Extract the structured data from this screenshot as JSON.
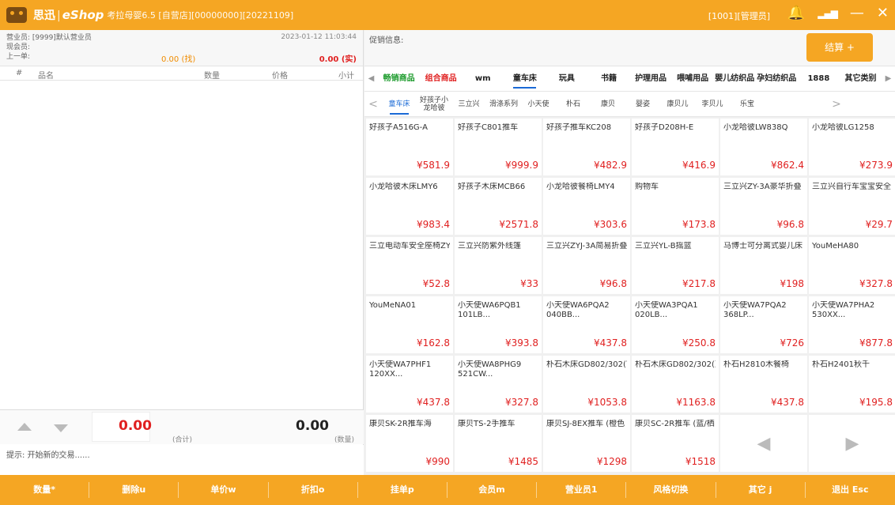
{
  "titlebar": {
    "brand": "思迅",
    "sep": "|",
    "product": "eShop",
    "subtitle": "考拉母婴6.5 [自营店][00000000][20221109]",
    "user": "[1001][管理员]"
  },
  "order": {
    "clerk": "营业员: [9999]默认营业员",
    "member": "现会员:",
    "last": "上一单:",
    "datetime": "2023-01-12 11:03:44",
    "change": "0.00 (找)",
    "paid": "0.00 (实)",
    "columns": [
      "#",
      "品名",
      "数量",
      "价格",
      "小计"
    ],
    "total_amount": "0.00",
    "total_label": "(合计)",
    "qty_amount": "0.00",
    "qty_label": "(数量)",
    "hint": "提示: 开始新的交易......"
  },
  "promo": {
    "label": "促销信息:",
    "checkout": "结算 +"
  },
  "categories": [
    "畅销商品",
    "组合商品",
    "wm",
    "童车床",
    "玩具",
    "书籍",
    "护理用品",
    "喂哺用品",
    "婴儿纺织品",
    "孕妇纺织品",
    "1888",
    "其它类别"
  ],
  "subcategories": [
    "童车床",
    "好孩子小龙哈彼",
    "三立兴",
    "滑涤系列",
    "小天使",
    "朴石",
    "康贝",
    "婴姿",
    "康贝儿",
    "李贝儿",
    "乐宝"
  ],
  "products": [
    {
      "name": "好孩子A516G-A",
      "price": "¥581.9"
    },
    {
      "name": "好孩子C801推车",
      "price": "¥999.9"
    },
    {
      "name": "好孩子推车KC208",
      "price": "¥482.9"
    },
    {
      "name": "好孩子D208H-E",
      "price": "¥416.9"
    },
    {
      "name": "小龙哈彼LW838Q",
      "price": "¥862.4"
    },
    {
      "name": "小龙哈彼LG1258",
      "price": "¥273.9"
    },
    {
      "name": "小龙哈彼木床LMY6",
      "price": "¥983.4"
    },
    {
      "name": "好孩子木床MCB66",
      "price": "¥2571.8"
    },
    {
      "name": "小龙哈彼餐椅LMY4",
      "price": "¥303.6"
    },
    {
      "name": "购物车",
      "price": "¥173.8"
    },
    {
      "name": "三立兴ZY-3A豪华折叠",
      "price": "¥96.8"
    },
    {
      "name": "三立兴自行车宝宝安全",
      "price": "¥29.7"
    },
    {
      "name": "三立电动车安全座椅ZY",
      "price": "¥52.8"
    },
    {
      "name": "三立兴防紫外线篷",
      "price": "¥33"
    },
    {
      "name": "三立兴ZYJ-3A简易折叠",
      "price": "¥96.8"
    },
    {
      "name": "三立兴YL-B摇篮",
      "price": "¥217.8"
    },
    {
      "name": "马博士可分离式婴儿床",
      "price": "¥198"
    },
    {
      "name": "YouMeHA80",
      "price": "¥327.8"
    },
    {
      "name": "YouMeNA01",
      "price": "¥162.8"
    },
    {
      "name": "小天使WA6PQB1 101LB...",
      "price": "¥393.8"
    },
    {
      "name": "小天使WA6PQA2 040BB...",
      "price": "¥437.8"
    },
    {
      "name": "小天使WA3PQA1 020LB...",
      "price": "¥250.8"
    },
    {
      "name": "小天使WA7PQA2 368LP...",
      "price": "¥726"
    },
    {
      "name": "小天使WA7PHA2 530XX...",
      "price": "¥877.8"
    },
    {
      "name": "小天使WA7PHF1 120XX...",
      "price": "¥437.8"
    },
    {
      "name": "小天使WA8PHG9 521CW...",
      "price": "¥327.8"
    },
    {
      "name": "朴石木床GD802/302(富",
      "price": "¥1053.8"
    },
    {
      "name": "朴石木床GD802/302(蓝",
      "price": "¥1163.8"
    },
    {
      "name": "朴石H2810木餐椅",
      "price": "¥437.8"
    },
    {
      "name": "朴石H2401秋千",
      "price": "¥195.8"
    },
    {
      "name": "康贝SK-2R推车海",
      "price": "¥990"
    },
    {
      "name": "康贝TS-2手推车",
      "price": "¥1485"
    },
    {
      "name": "康贝SJ-8EX推车 (橙色",
      "price": "¥1298"
    },
    {
      "name": "康贝SC-2R推车 (蓝/栖",
      "price": "¥1518"
    }
  ],
  "function_keys": [
    "数量*",
    "删除u",
    "单价w",
    "折扣o",
    "挂单p",
    "会员m",
    "营业员1",
    "风格切换",
    "其它 j",
    "退出 Esc"
  ],
  "colors": {
    "accent": "#f5a623",
    "price": "#e02020",
    "active_tab": "#1a6ad6"
  }
}
